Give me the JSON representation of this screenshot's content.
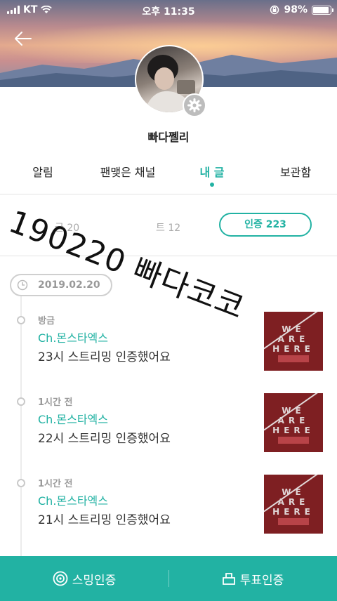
{
  "status_bar": {
    "carrier": "KT",
    "time": "오후 11:35",
    "battery": "98%",
    "battery_level": 0.98
  },
  "profile": {
    "username": "빠다쩰리"
  },
  "tabs": [
    {
      "label": "알림",
      "active": false
    },
    {
      "label": "팬맺은 채널",
      "active": false
    },
    {
      "label": "내 글",
      "active": true
    },
    {
      "label": "보관함",
      "active": false
    }
  ],
  "stats": {
    "left": "글 20",
    "middle": "트 12",
    "cert_button": "인증 223"
  },
  "overlay": "190220 빠다코코",
  "timeline": {
    "date": "2019.02.20",
    "posts": [
      {
        "time": "방금",
        "channel": "Ch.몬스타엑스",
        "text": "23시 스트리밍 인증했어요",
        "thumb_text": "WE ARE HERE"
      },
      {
        "time": "1시간 전",
        "channel": "Ch.몬스타엑스",
        "text": "22시 스트리밍 인증했어요",
        "thumb_text": "WE ARE HERE"
      },
      {
        "time": "1시간 전",
        "channel": "Ch.몬스타엑스",
        "text": "21시 스트리밍 인증했어요",
        "thumb_text": "WE ARE HERE"
      }
    ]
  },
  "bottom_bar": {
    "left": "스밍인증",
    "right": "투표인증"
  },
  "colors": {
    "accent": "#22b2a3"
  }
}
